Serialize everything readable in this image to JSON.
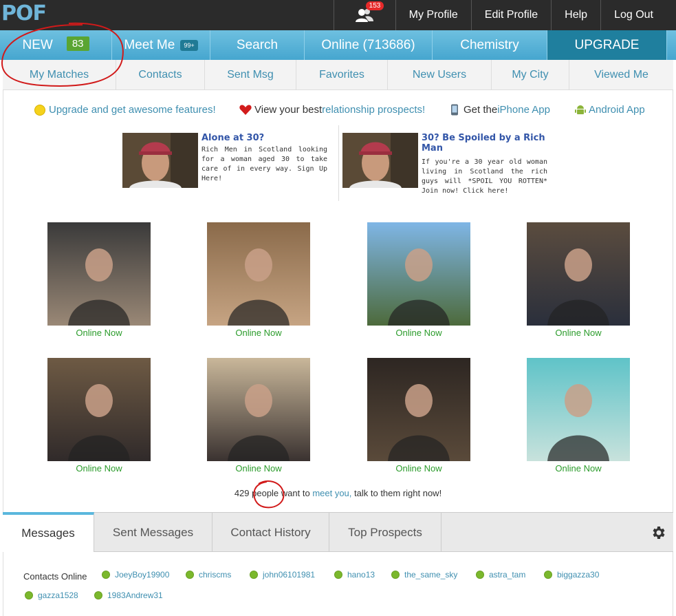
{
  "topbar": {
    "logo": "POF",
    "friend_badge": "153",
    "links": [
      "My Profile",
      "Edit Profile",
      "Help",
      "Log Out"
    ]
  },
  "mainnav": {
    "new_label": "NEW",
    "new_count": "83",
    "meetme_label": "Meet Me",
    "meetme_count": "99+",
    "search": "Search",
    "online": "Online (713686)",
    "chemistry": "Chemistry",
    "upgrade": "UPGRADE"
  },
  "subnav": [
    "My Matches",
    "Contacts",
    "Sent Msg",
    "Favorites",
    "New Users",
    "My City",
    "Viewed Me"
  ],
  "features": {
    "upgrade": "Upgrade and get awesome features!",
    "view_prefix": "View your best ",
    "view_link": "relationship prospects!",
    "iphone_prefix": "Get the ",
    "iphone_link": "iPhone App",
    "android": "Android App"
  },
  "ads": [
    {
      "title": "Alone at 30?",
      "body": "Rich Men in Scotland looking for a woman aged 30 to take care of in every way. Sign Up Here!"
    },
    {
      "title": "30? Be Spoiled by a Rich Man",
      "body": "If you're a 30 year old woman living in Scotland the rich guys will *SPOIL YOU ROTTEN* Join now! Click here!"
    }
  ],
  "profiles": [
    {
      "status": "Online Now",
      "colors": [
        "#3a3a3a",
        "#9a8876"
      ]
    },
    {
      "status": "Online Now",
      "colors": [
        "#8a6a4a",
        "#c6a483"
      ]
    },
    {
      "status": "Online Now",
      "colors": [
        "#7fb6e6",
        "#4d6a3b"
      ]
    },
    {
      "status": "Online Now",
      "colors": [
        "#5b4c3e",
        "#2a2f3c"
      ]
    },
    {
      "status": "Online Now",
      "colors": [
        "#6e5a44",
        "#302a2a"
      ]
    },
    {
      "status": "Online Now",
      "colors": [
        "#c9b79a",
        "#3a3230"
      ]
    },
    {
      "status": "Online Now",
      "colors": [
        "#2d2622",
        "#5a4a3a"
      ]
    },
    {
      "status": "Online Now",
      "colors": [
        "#5fc3c8",
        "#c8e2dc"
      ]
    }
  ],
  "meet": {
    "count": "429",
    "middle": " people want to ",
    "link": "meet you,",
    "suffix": " talk to them right now!"
  },
  "messages": {
    "tabs": [
      "Messages",
      "Sent Messages",
      "Contact History",
      "Top Prospects"
    ],
    "contacts_label": "Contacts Online",
    "contacts": [
      "JoeyBoy19900",
      "chriscms",
      "john06101981",
      "hano13",
      "the_same_sky",
      "astra_tam",
      "biggazza30",
      "gazza1528",
      "1983Andrew31"
    ]
  },
  "colors": {
    "topbar": "#2b2b2b",
    "nav_blue": "#46a6cf",
    "upgrade": "#1f7f9e",
    "link": "#3f8fb0",
    "online_green": "#2a9b2a",
    "annotation_red": "#d11a1a"
  }
}
